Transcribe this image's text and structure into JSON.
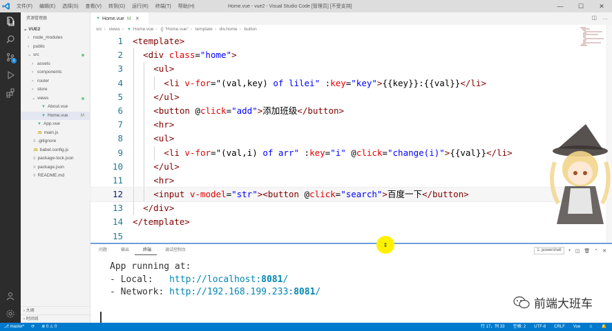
{
  "titlebar": {
    "menu": [
      "文件(F)",
      "编辑(E)",
      "选择(S)",
      "查看(V)",
      "转到(G)",
      "运行(R)",
      "终端(T)",
      "帮助(H)"
    ],
    "title": "Home.vue - vue2 - Visual Studio Code [管理员] [不受支持]"
  },
  "activity": {
    "scm_badge": "1"
  },
  "sidebar": {
    "header": "资源管理器",
    "project": "VUE2",
    "items": [
      {
        "label": "node_modules",
        "depth": 1,
        "kind": "folder",
        "chevron": "›",
        "status": ""
      },
      {
        "label": "public",
        "depth": 1,
        "kind": "folder",
        "chevron": "›",
        "status": ""
      },
      {
        "label": "src",
        "depth": 1,
        "kind": "folder",
        "chevron": "⌄",
        "status": "dot"
      },
      {
        "label": "assets",
        "depth": 2,
        "kind": "folder",
        "chevron": "›",
        "status": ""
      },
      {
        "label": "components",
        "depth": 2,
        "kind": "folder",
        "chevron": "›",
        "status": ""
      },
      {
        "label": "router",
        "depth": 2,
        "kind": "folder",
        "chevron": "›",
        "status": ""
      },
      {
        "label": "store",
        "depth": 2,
        "kind": "folder",
        "chevron": "›",
        "status": ""
      },
      {
        "label": "views",
        "depth": 2,
        "kind": "folder",
        "chevron": "⌄",
        "status": "dot"
      },
      {
        "label": "About.vue",
        "depth": 3,
        "kind": "vue",
        "chevron": "",
        "status": ""
      },
      {
        "label": "Home.vue",
        "depth": 3,
        "kind": "vue",
        "chevron": "",
        "status": "M",
        "active": true
      },
      {
        "label": "App.vue",
        "depth": 2,
        "kind": "vue",
        "chevron": "",
        "status": ""
      },
      {
        "label": "main.js",
        "depth": 2,
        "kind": "js",
        "chevron": "",
        "status": ""
      },
      {
        "label": ".gitignore",
        "depth": 1,
        "kind": "file",
        "chevron": "",
        "status": ""
      },
      {
        "label": "babel.config.js",
        "depth": 1,
        "kind": "js",
        "chevron": "",
        "status": ""
      },
      {
        "label": "package-lock.json",
        "depth": 1,
        "kind": "file",
        "chevron": "",
        "status": ""
      },
      {
        "label": "package.json",
        "depth": 1,
        "kind": "file",
        "chevron": "",
        "status": ""
      },
      {
        "label": "README.md",
        "depth": 1,
        "kind": "file",
        "chevron": "",
        "status": ""
      }
    ],
    "outline": [
      "› 大纲",
      "› 时间线"
    ]
  },
  "tab": {
    "label": "Home.vue",
    "modified": "M"
  },
  "breadcrumb": [
    "src",
    "views",
    "Home.vue",
    "{} \"Home.vue\"",
    "template",
    "div.home",
    "button"
  ],
  "code": [
    {
      "n": "1",
      "indent": 0,
      "tokens": [
        [
          "t-tag",
          "<template>"
        ]
      ]
    },
    {
      "n": "2",
      "indent": 1,
      "tokens": [
        [
          "t-tag",
          "<div"
        ],
        [
          "t-txt",
          " "
        ],
        [
          "t-attr",
          "class"
        ],
        [
          "t-txt",
          "="
        ],
        [
          "t-str",
          "\"home\""
        ],
        [
          "t-tag",
          ">"
        ]
      ]
    },
    {
      "n": "3",
      "indent": 2,
      "tokens": [
        [
          "t-tag",
          "<ul>"
        ]
      ]
    },
    {
      "n": "4",
      "indent": 3,
      "tokens": [
        [
          "t-tag",
          "<li"
        ],
        [
          "t-txt",
          " "
        ],
        [
          "t-attr",
          "v-for"
        ],
        [
          "t-txt",
          "=\"(val,key) "
        ],
        [
          "t-kw",
          "of"
        ],
        [
          "t-txt",
          " "
        ],
        [
          "t-str",
          "lilei\""
        ],
        [
          "t-txt",
          " :"
        ],
        [
          "t-attr",
          "key"
        ],
        [
          "t-txt",
          "="
        ],
        [
          "t-str",
          "\"key\""
        ],
        [
          "t-tag",
          ">"
        ],
        [
          "t-txt",
          "{{key}}:{{val}}"
        ],
        [
          "t-tag",
          "</li>"
        ]
      ]
    },
    {
      "n": "5",
      "indent": 2,
      "tokens": [
        [
          "t-tag",
          "</ul>"
        ]
      ]
    },
    {
      "n": "6",
      "indent": 2,
      "tokens": [
        [
          "t-tag",
          "<button"
        ],
        [
          "t-txt",
          " @"
        ],
        [
          "t-attr",
          "click"
        ],
        [
          "t-txt",
          "="
        ],
        [
          "t-str",
          "\"add\""
        ],
        [
          "t-tag",
          ">"
        ],
        [
          "t-txt",
          "添加班级"
        ],
        [
          "t-tag",
          "</button>"
        ]
      ]
    },
    {
      "n": "7",
      "indent": 2,
      "tokens": [
        [
          "t-tag",
          "<hr>"
        ]
      ]
    },
    {
      "n": "8",
      "indent": 2,
      "tokens": [
        [
          "t-tag",
          "<ul>"
        ]
      ]
    },
    {
      "n": "9",
      "indent": 3,
      "tokens": [
        [
          "t-tag",
          "<li"
        ],
        [
          "t-txt",
          " "
        ],
        [
          "t-attr",
          "v-for"
        ],
        [
          "t-txt",
          "=\"(val,i) "
        ],
        [
          "t-kw",
          "of"
        ],
        [
          "t-txt",
          " "
        ],
        [
          "t-str",
          "arr\""
        ],
        [
          "t-txt",
          " :"
        ],
        [
          "t-attr",
          "key"
        ],
        [
          "t-txt",
          "="
        ],
        [
          "t-str",
          "\"i\""
        ],
        [
          "t-txt",
          " @"
        ],
        [
          "t-attr",
          "click"
        ],
        [
          "t-txt",
          "="
        ],
        [
          "t-str",
          "\"change(i)\""
        ],
        [
          "t-tag",
          ">"
        ],
        [
          "t-txt",
          "{{val}}"
        ],
        [
          "t-tag",
          "</li>"
        ]
      ]
    },
    {
      "n": "10",
      "indent": 2,
      "tokens": [
        [
          "t-tag",
          "</ul>"
        ]
      ]
    },
    {
      "n": "11",
      "indent": 2,
      "tokens": [
        [
          "t-tag",
          "<hr>"
        ]
      ]
    },
    {
      "n": "12",
      "indent": 2,
      "current": true,
      "tokens": [
        [
          "t-tag",
          "<input"
        ],
        [
          "t-txt",
          " "
        ],
        [
          "t-attr",
          "v-model"
        ],
        [
          "t-txt",
          "="
        ],
        [
          "t-str",
          "\"str\""
        ],
        [
          "t-tag",
          "><button"
        ],
        [
          "t-txt",
          " @"
        ],
        [
          "t-attr",
          "click"
        ],
        [
          "t-txt",
          "="
        ],
        [
          "t-str",
          "\"search\""
        ],
        [
          "t-tag",
          ">"
        ],
        [
          "t-txt",
          "百度一下"
        ],
        [
          "t-tag",
          "</button>"
        ]
      ]
    },
    {
      "n": "13",
      "indent": 1,
      "tokens": [
        [
          "t-tag",
          "</div>"
        ]
      ]
    },
    {
      "n": "14",
      "indent": 0,
      "tokens": [
        [
          "t-tag",
          "</template>"
        ]
      ]
    },
    {
      "n": "15",
      "indent": 0,
      "tokens": []
    }
  ],
  "panel": {
    "tabs": [
      "问题",
      "输出",
      "终端",
      "调试控制台"
    ],
    "active_tab": 2,
    "shell": "1: powershell",
    "terminal": {
      "line1": "App running at:",
      "local_label": "- Local:   ",
      "local_url": "http://localhost:",
      "local_port": "8081",
      "local_tail": "/",
      "network_label": "- Network: ",
      "network_url": "http://192.168.199.233:",
      "network_port": "8081",
      "network_tail": "/"
    },
    "watermark": "前端大班车"
  },
  "statusbar": {
    "branch": "master*",
    "sync": "⟳",
    "problems": "⊗ 0 ⚠ 0",
    "position": "行 17，列 33",
    "spaces": "空格: 2",
    "encoding": "UTF-8",
    "eol": "CRLF",
    "language": "Vue",
    "feedback": "☺",
    "bell": "🔔"
  },
  "colors": {
    "accent": "#007acc",
    "tag": "#800000",
    "attr": "#e50000",
    "string": "#0000ff",
    "activity_bg": "#2c2c2c",
    "sash_highlight": "#fff200"
  }
}
